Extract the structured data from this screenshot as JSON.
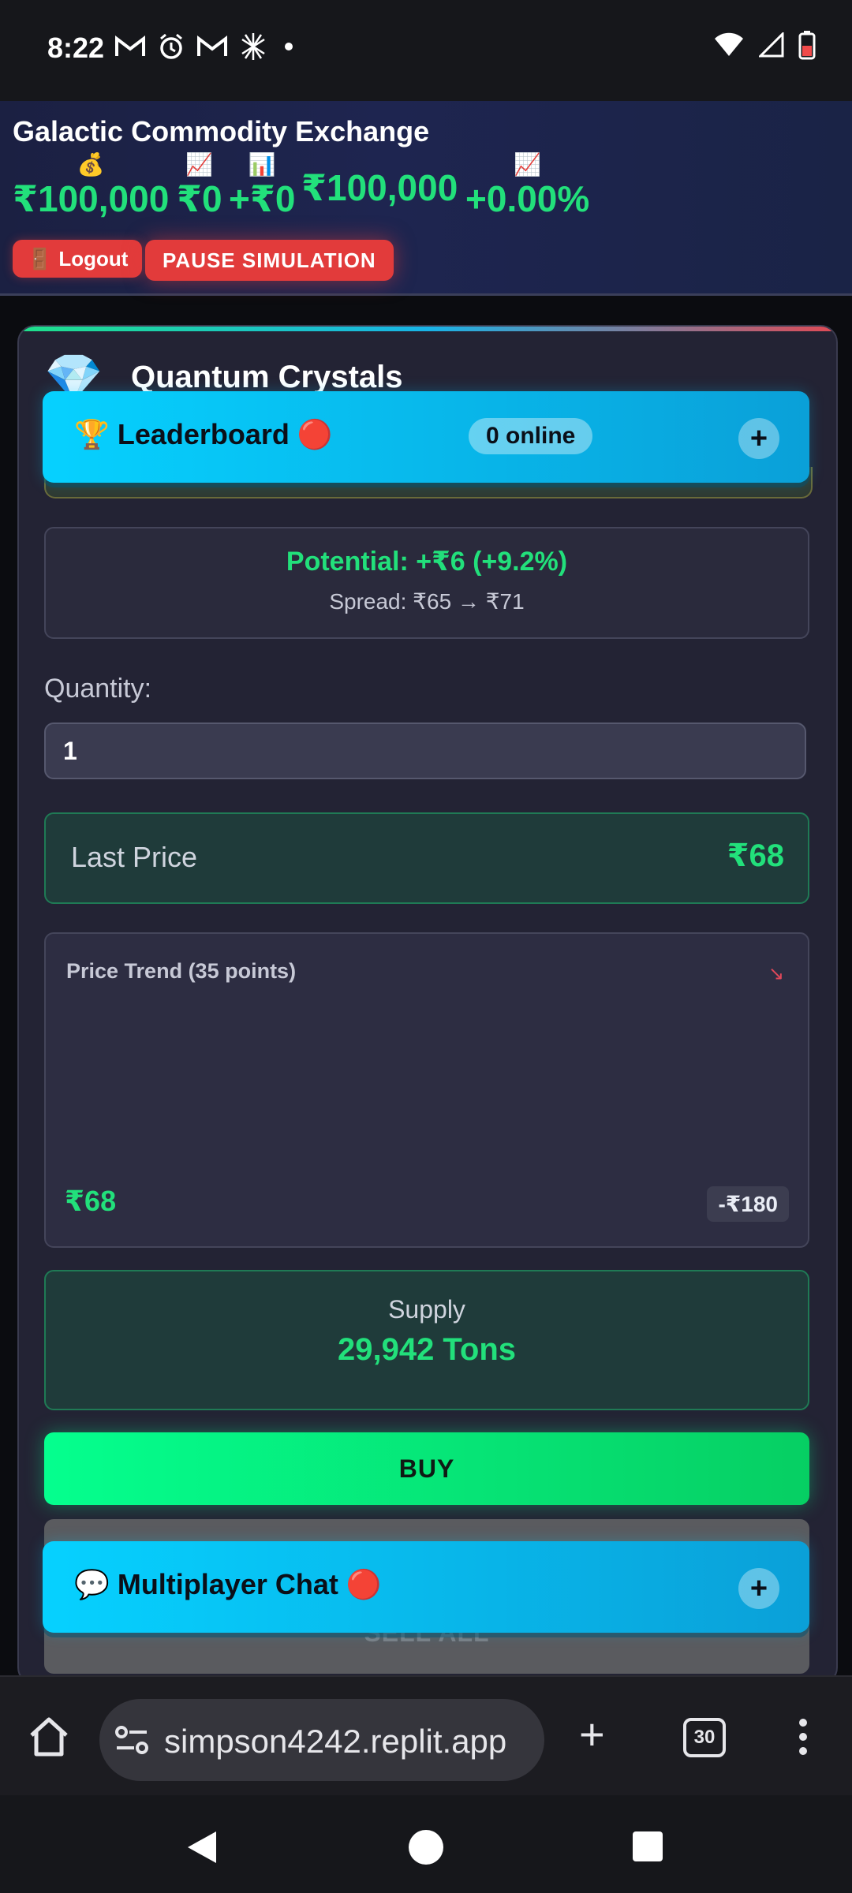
{
  "status_bar": {
    "time": "8:22",
    "left_icons": [
      "gmail-icon",
      "alarm-icon",
      "gmail-icon",
      "app-icon",
      "dot"
    ],
    "right_icons": [
      "wifi-icon",
      "signal-icon",
      "battery-icon"
    ]
  },
  "header": {
    "title": "Galactic Commodity Exchange",
    "stats": [
      {
        "emoji": "💰",
        "value": "₹100,000"
      },
      {
        "emoji": "📈",
        "value": "₹0"
      },
      {
        "emoji": "📊",
        "value": "+₹0"
      },
      {
        "emoji": "",
        "value": "₹100,000"
      },
      {
        "emoji": "📈",
        "value": "+0.00%"
      }
    ],
    "logout_emoji": "🚪",
    "logout_label": "Logout",
    "pause_label": "PAUSE SIMULATION"
  },
  "commodity": {
    "icon": "💎",
    "name": "Quantum Crystals",
    "potential": "Potential: +₹6 (+9.2%)",
    "spread": "Spread: ₹65 → ₹71",
    "quantity_label": "Quantity:",
    "quantity_value": "1",
    "last_price_label": "Last Price",
    "last_price_value": "₹68",
    "trend_title": "Price Trend (35 points)",
    "trend_arrow": "↘",
    "trend_current": "₹68",
    "trend_change": "-₹180",
    "supply_label": "Supply",
    "supply_value": "29,942 Tons",
    "buy_label": "BUY",
    "sell_all_label": "SELL ALL"
  },
  "leaderboard": {
    "title": "🏆 Leaderboard 🔴",
    "online": "0 online",
    "toggle": "+"
  },
  "chat": {
    "title": "💬 Multiplayer Chat 🔴",
    "toggle": "+"
  },
  "browser": {
    "url": "simpson4242.replit.app",
    "tab_count": "30"
  },
  "colors": {
    "accent_green": "#22e07b",
    "danger_red": "#e23b3b",
    "panel_cyan": "#06d1ff"
  }
}
